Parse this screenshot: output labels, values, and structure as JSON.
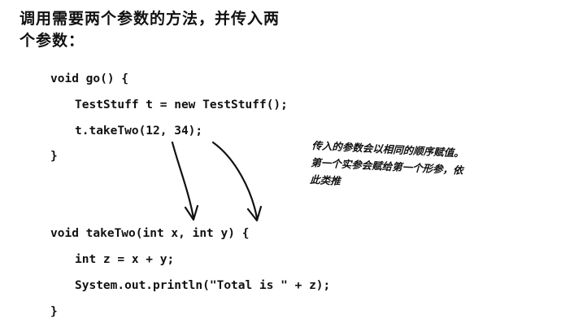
{
  "heading": {
    "line1": "调用需要两个参数的方法，并传入两",
    "line2": "个参数："
  },
  "code": {
    "go_signature": "void go() {",
    "go_line1": "TestStuff t = new TestStuff();",
    "go_line2": "t.takeTwo(12, 34);",
    "go_close": "}",
    "taketwo_signature": "void takeTwo(int x, int y) {",
    "taketwo_line1": "int z = x + y;",
    "taketwo_line2": "System.out.println(\"Total is \" + z);",
    "taketwo_close": "}"
  },
  "annotation": {
    "line1": "传入的参数会以相同的顺序赋值。",
    "line2": "第一个实参会赋给第一个形参，依",
    "line3": "此类推"
  }
}
